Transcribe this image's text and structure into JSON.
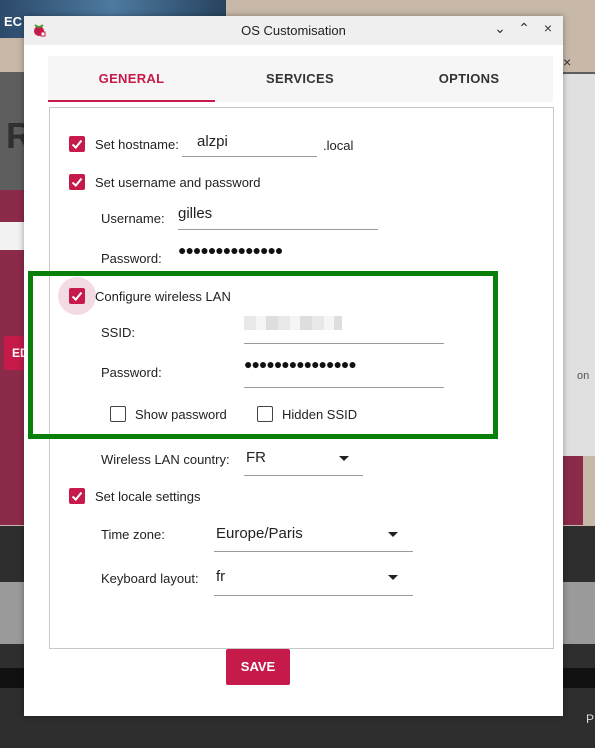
{
  "background": {
    "photo_label": "EC",
    "big_letter": "R",
    "red_button_label": "ED",
    "right_text": "on",
    "corner_text": "P",
    "close_glyph": "×"
  },
  "dialog": {
    "title": "OS Customisation",
    "window_controls": {
      "minimize": "⌄",
      "maximize": "⌃",
      "close": "×"
    }
  },
  "tabs": [
    {
      "label": "GENERAL",
      "active": true
    },
    {
      "label": "SERVICES",
      "active": false
    },
    {
      "label": "OPTIONS",
      "active": false
    }
  ],
  "hostname": {
    "label": "Set hostname:",
    "value": "alzpi",
    "suffix": ".local",
    "checked": true
  },
  "user": {
    "label": "Set username and password",
    "checked": true,
    "username_label": "Username:",
    "username_value": "gilles",
    "password_label": "Password:",
    "password_value": "●●●●●●●●●●●●●●"
  },
  "wifi": {
    "label": "Configure wireless LAN",
    "checked": true,
    "ssid_label": "SSID:",
    "password_label": "Password:",
    "password_value": "●●●●●●●●●●●●●●●",
    "show_password_label": "Show password",
    "show_password_checked": false,
    "hidden_ssid_label": "Hidden SSID",
    "hidden_ssid_checked": false,
    "country_label": "Wireless LAN country:",
    "country_value": "FR"
  },
  "locale": {
    "label": "Set locale settings",
    "checked": true,
    "timezone_label": "Time zone:",
    "timezone_value": "Europe/Paris",
    "keyboard_label": "Keyboard layout:",
    "keyboard_value": "fr"
  },
  "save_label": "SAVE",
  "colors": {
    "accent": "#c51a4a",
    "highlight": "#0a7f0a"
  }
}
